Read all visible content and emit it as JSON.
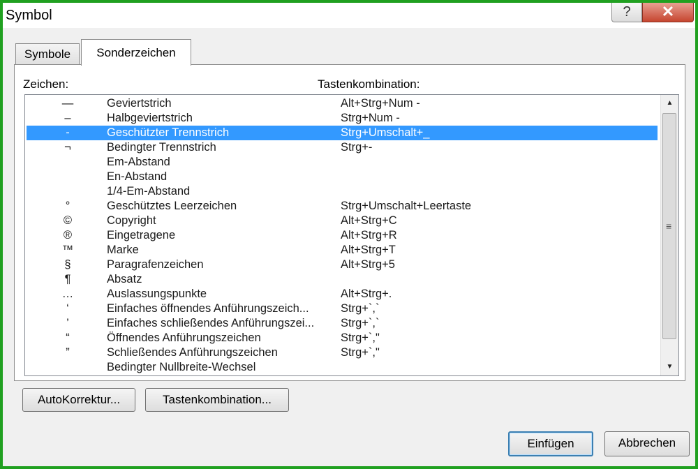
{
  "window": {
    "title": "Symbol",
    "help_label": "?",
    "close_label": "✕"
  },
  "tabs": [
    {
      "label": "Symbole",
      "active": false
    },
    {
      "label": "Sonderzeichen",
      "active": true
    }
  ],
  "columns": {
    "char": "Zeichen:",
    "key": "Tastenkombination:"
  },
  "rows": [
    {
      "char": "—",
      "name": "Geviertstrich",
      "key": "Alt+Strg+Num -"
    },
    {
      "char": "–",
      "name": "Halbgeviertstrich",
      "key": "Strg+Num -"
    },
    {
      "char": "-",
      "name": "Geschützter Trennstrich",
      "key": "Strg+Umschalt+_"
    },
    {
      "char": "¬",
      "name": "Bedingter Trennstrich",
      "key": "Strg+-"
    },
    {
      "char": "",
      "name": "Em-Abstand",
      "key": ""
    },
    {
      "char": "",
      "name": "En-Abstand",
      "key": ""
    },
    {
      "char": "",
      "name": "1/4-Em-Abstand",
      "key": ""
    },
    {
      "char": "°",
      "name": "Geschütztes Leerzeichen",
      "key": "Strg+Umschalt+Leertaste"
    },
    {
      "char": "©",
      "name": "Copyright",
      "key": "Alt+Strg+C"
    },
    {
      "char": "®",
      "name": "Eingetragene",
      "key": "Alt+Strg+R"
    },
    {
      "char": "™",
      "name": "Marke",
      "key": "Alt+Strg+T"
    },
    {
      "char": "§",
      "name": "Paragrafenzeichen",
      "key": "Alt+Strg+5"
    },
    {
      "char": "¶",
      "name": "Absatz",
      "key": ""
    },
    {
      "char": "…",
      "name": "Auslassungspunkte",
      "key": "Alt+Strg+."
    },
    {
      "char": "‘",
      "name": "Einfaches öffnendes Anführungszeich...",
      "key": "Strg+`,`"
    },
    {
      "char": "’",
      "name": "Einfaches schließendes Anführungszei...",
      "key": "Strg+`,`"
    },
    {
      "char": "“",
      "name": "Öffnendes Anführungszeichen",
      "key": "Strg+`,\""
    },
    {
      "char": "”",
      "name": "Schließendes Anführungszeichen",
      "key": "Strg+`,\""
    },
    {
      "char": "",
      "name": "Bedingter Nullbreite-Wechsel",
      "key": ""
    }
  ],
  "selected_row": 2,
  "scrollbar": {
    "up_icon": "▲",
    "down_icon": "▼",
    "grip_icon": "≡"
  },
  "buttons": {
    "autokorrektur": "AutoKorrektur...",
    "tastenkombination": "Tastenkombination...",
    "einfuegen": "Einfügen",
    "abbrechen": "Abbrechen"
  },
  "colors": {
    "selection": "#3399ff",
    "window_border": "#20a020",
    "close_button": "#c6452f"
  }
}
